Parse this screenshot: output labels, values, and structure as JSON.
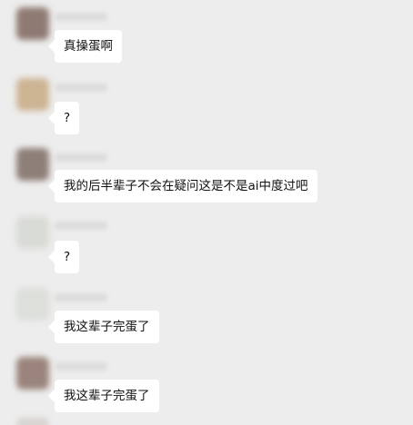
{
  "messages": [
    {
      "text": "真操蛋啊",
      "avatar_color": "#8f7a73"
    },
    {
      "text": "?",
      "avatar_color": "#cdb493"
    },
    {
      "text": "我的后半辈子不会在疑问这是不是ai中度过吧",
      "avatar_color": "#8e7f78"
    },
    {
      "text": "?",
      "avatar_color": "#d9dbd6"
    },
    {
      "text": "我这辈子完蛋了",
      "avatar_color": "#dcdfda"
    },
    {
      "text": "我这辈子完蛋了",
      "avatar_color": "#9a847c"
    }
  ]
}
